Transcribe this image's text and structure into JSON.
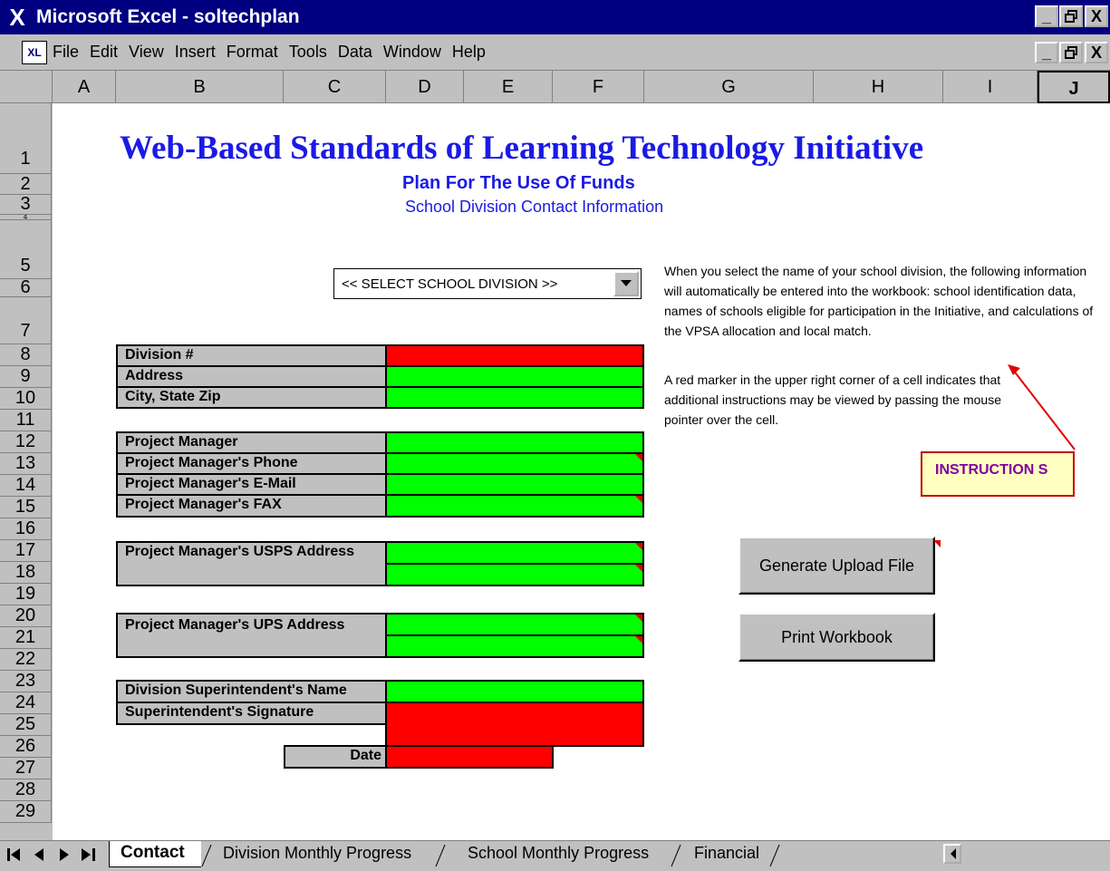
{
  "window": {
    "title": "Microsoft Excel - soltechplan",
    "min": "_",
    "max": "▯",
    "close": "X"
  },
  "menu": [
    "File",
    "Edit",
    "View",
    "Insert",
    "Format",
    "Tools",
    "Data",
    "Window",
    "Help"
  ],
  "columns": [
    "A",
    "B",
    "C",
    "D",
    "E",
    "F",
    "G",
    "H",
    "I",
    "J"
  ],
  "rows": [
    "1",
    "2",
    "3",
    "4",
    "5",
    "6",
    "7",
    "8",
    "9",
    "10",
    "11",
    "12",
    "13",
    "14",
    "15",
    "16",
    "17",
    "18",
    "19",
    "20",
    "21",
    "22",
    "23",
    "24",
    "25",
    "26",
    "27",
    "28",
    "29"
  ],
  "header": {
    "title": "Web-Based Standards of Learning Technology Initiative",
    "subtitle": "Plan For The Use Of Funds",
    "section": "School Division Contact Information"
  },
  "division_select": {
    "value": "<< SELECT SCHOOL DIVISION >>"
  },
  "fields": {
    "division_no": "Division #",
    "address": "Address",
    "city_state_zip": "City, State  Zip",
    "pm": "Project Manager",
    "pm_phone": "Project Manager's Phone",
    "pm_email": "Project Manager's E-Mail",
    "pm_fax": "Project Manager's FAX",
    "pm_usps": "Project Manager's USPS Address",
    "pm_ups": "Project Manager's UPS Address",
    "supt_name": "Division Superintendent's Name",
    "supt_sig": "Superintendent's Signature",
    "date": "Date"
  },
  "instructions": {
    "para1": "When you select the name of your school division, the following information will automatically be entered into the workbook: school identification data, names of schools eligible for participation in the Initiative, and calculations of the VPSA allocation and local match.",
    "para2": "A red marker in the upper right corner of a cell indicates that additional instructions may be viewed by passing the mouse pointer over the cell.",
    "note": "INSTRUCTION S"
  },
  "buttons": {
    "generate": "Generate Upload File",
    "print": "Print Workbook"
  },
  "tabs": [
    "Contact",
    "Division Monthly Progress",
    "School Monthly Progress",
    "Financial"
  ],
  "colors": {
    "titlebar": "#000080",
    "field_green": "#00ff00",
    "field_red": "#ff0000",
    "heading_blue": "#1a1ae6"
  }
}
